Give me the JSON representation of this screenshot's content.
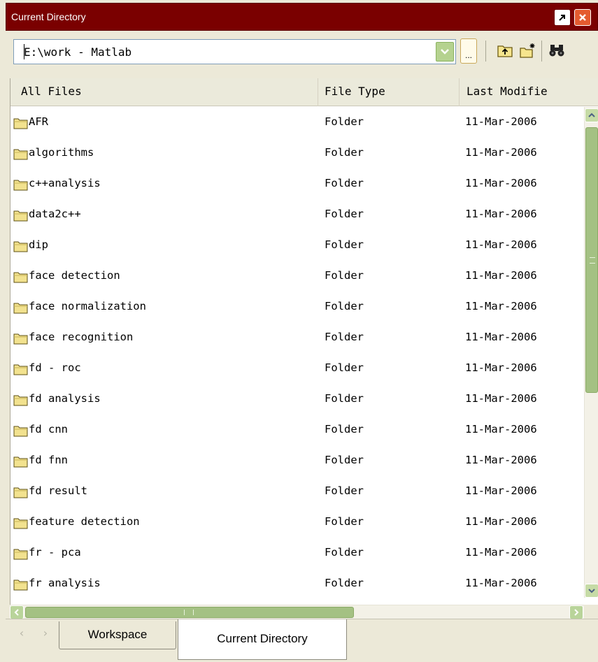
{
  "window": {
    "title": "Current Directory",
    "undock_icon": "undock-arrow-icon",
    "close_icon": "close-icon"
  },
  "toolbar": {
    "path": "E:\\work - Matlab",
    "browse_label": "...",
    "icons": [
      "dropdown-arrow-icon",
      "up-folder-icon",
      "new-folder-icon",
      "find-binoculars-icon"
    ]
  },
  "table": {
    "columns": [
      "All Files",
      "File Type",
      "Last Modifie"
    ],
    "rows": [
      {
        "name": "AFR",
        "type": "Folder",
        "modified": "11-Mar-2006"
      },
      {
        "name": "algorithms",
        "type": "Folder",
        "modified": "11-Mar-2006"
      },
      {
        "name": "c++analysis",
        "type": "Folder",
        "modified": "11-Mar-2006"
      },
      {
        "name": "data2c++",
        "type": "Folder",
        "modified": "11-Mar-2006"
      },
      {
        "name": "dip",
        "type": "Folder",
        "modified": "11-Mar-2006"
      },
      {
        "name": "face detection",
        "type": "Folder",
        "modified": "11-Mar-2006"
      },
      {
        "name": "face normalization",
        "type": "Folder",
        "modified": "11-Mar-2006"
      },
      {
        "name": "face recognition",
        "type": "Folder",
        "modified": "11-Mar-2006"
      },
      {
        "name": "fd - roc",
        "type": "Folder",
        "modified": "11-Mar-2006"
      },
      {
        "name": "fd analysis",
        "type": "Folder",
        "modified": "11-Mar-2006"
      },
      {
        "name": "fd cnn",
        "type": "Folder",
        "modified": "11-Mar-2006"
      },
      {
        "name": "fd fnn",
        "type": "Folder",
        "modified": "11-Mar-2006"
      },
      {
        "name": "fd result",
        "type": "Folder",
        "modified": "11-Mar-2006"
      },
      {
        "name": "feature detection",
        "type": "Folder",
        "modified": "11-Mar-2006"
      },
      {
        "name": "fr - pca",
        "type": "Folder",
        "modified": "11-Mar-2006"
      },
      {
        "name": "fr analysis",
        "type": "Folder",
        "modified": "11-Mar-2006"
      }
    ]
  },
  "tabs": [
    "Workspace",
    "Current Directory"
  ],
  "colors": {
    "titlebar": "#7a0000",
    "scrollbar": "#a4c183",
    "folder": "#f2e28f"
  }
}
